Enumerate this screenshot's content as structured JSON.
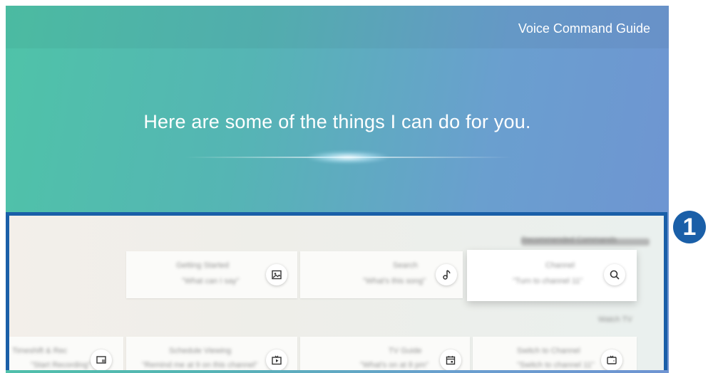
{
  "header": {
    "title": "Voice Command Guide"
  },
  "hero": {
    "text": "Here are some of the things I can do for you."
  },
  "callout": {
    "number": "1"
  },
  "sections": [
    {
      "label": "Recommended Commands"
    },
    {
      "label": "Watch TV"
    }
  ],
  "cards_row1": [
    {
      "title": "Channel",
      "subtitle": "\"Turn to channel 11\"",
      "icon": "search-icon"
    },
    {
      "title": "Search",
      "subtitle": "\"What's this song\"",
      "icon": "music-note-icon"
    },
    {
      "title": "Getting Started",
      "subtitle": "\"What can I say\"",
      "icon": "image-icon"
    }
  ],
  "cards_row2": [
    {
      "title": "Switch to Channel",
      "subtitle": "\"Switch to channel 11\"",
      "icon": "channel-switch-icon"
    },
    {
      "title": "TV Guide",
      "subtitle": "\"What's on at 8 pm\"",
      "icon": "calendar-icon"
    },
    {
      "title": "Schedule Viewing",
      "subtitle": "\"Remind me at 9 on this channel\"",
      "icon": "tv-play-icon"
    },
    {
      "title": "Timeshift & Rec",
      "subtitle": "\"Start Recording\"",
      "icon": "screen-list-icon"
    }
  ],
  "colors": {
    "accent": "#1a5fa8",
    "hero_start": "#4fc3a8",
    "hero_end": "#6f94d2"
  }
}
